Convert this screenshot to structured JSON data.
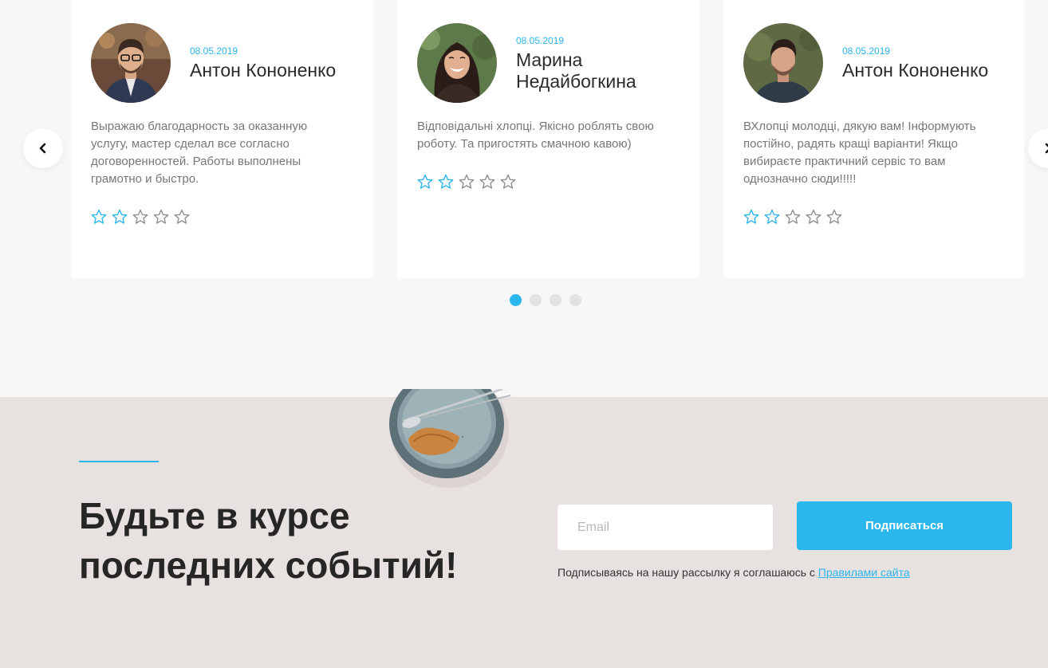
{
  "reviews": [
    {
      "date": "08.05.2019",
      "name": "Антон Кононенко",
      "text": "Выражаю благодарность за оказанную услугу, мастер сделал все согласно договоренностей. Работы выполнены грамотно и быстро.",
      "rating": 2,
      "max_rating": 5
    },
    {
      "date": "08.05.2019",
      "name": "Марина Недайбогкина",
      "text": "Відповідальні хлопці. Якісно роблять свою роботу. Та пригостять смачною кавою)",
      "rating": 2,
      "max_rating": 5
    },
    {
      "date": "08.05.2019",
      "name": "Антон Кононенко",
      "text": "ВХлопці молодці, дякую вам! Інформують постійно, радять кращі варіанти! Якщо вибираєте практичний сервіс то вам однозначно сюди!!!!!",
      "rating": 2,
      "max_rating": 5
    }
  ],
  "carousel": {
    "prev_icon": "chevron-left-icon",
    "next_icon": "chevron-right-icon",
    "page_count": 4,
    "active_page": 1
  },
  "subscribe": {
    "heading": "Будьте в курсе последних событий!",
    "email_placeholder": "Email",
    "button_label": "Подписаться",
    "agree_text": "Подписываясь на нашу рассылку я соглашаюсь с ",
    "agree_link": "Правилами сайта"
  },
  "colors": {
    "accent": "#2cb6ee",
    "section_bg": "#f7f7f7",
    "subscribe_bg": "#e7e1df",
    "star_empty": "#8f8f8f"
  }
}
